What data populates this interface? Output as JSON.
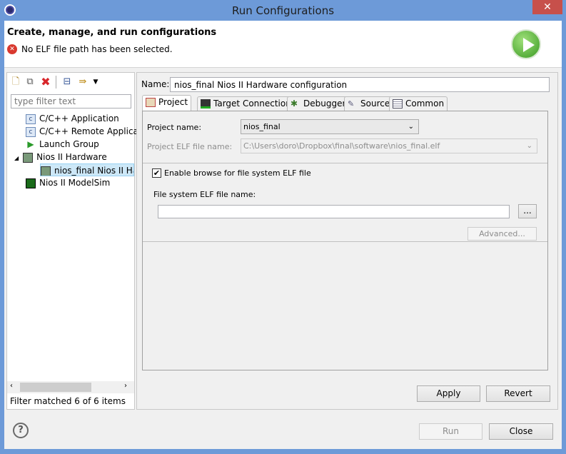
{
  "window": {
    "title": "Run Configurations",
    "close": "✕"
  },
  "header": {
    "title": "Create, manage, and run configurations",
    "error": "No ELF file path has been selected."
  },
  "toolbar": {
    "icons": [
      "new-config-icon",
      "duplicate-icon",
      "delete-icon",
      "collapse-all-icon",
      "filter-icon",
      "dropdown-icon"
    ]
  },
  "filter": {
    "placeholder": "type filter text"
  },
  "tree": [
    {
      "label": "C/C++ Application",
      "icon": "c-app-icon"
    },
    {
      "label": "C/C++ Remote Applicat",
      "icon": "c-app-icon"
    },
    {
      "label": "Launch Group",
      "icon": "launch-group-icon"
    },
    {
      "label": "Nios II Hardware",
      "icon": "nios-hardware-icon",
      "expanded": true
    },
    {
      "label": "nios_final Nios II Har",
      "icon": "nios-hardware-icon",
      "selected": true
    },
    {
      "label": "Nios II ModelSim",
      "icon": "modelsim-icon"
    }
  ],
  "status": "Filter matched 6 of 6 items",
  "config": {
    "name_label": "Name:",
    "name": "nios_final Nios II Hardware configuration"
  },
  "tabs": [
    "Project",
    "Target Connection",
    "Debugger",
    "Source",
    "Common"
  ],
  "project": {
    "project_name_label": "Project name:",
    "project_name": "nios_final",
    "elf_label": "Project ELF file name:",
    "elf_value": "C:\\Users\\doro\\Dropbox\\final\\software\\nios_final.elf",
    "browse_checkbox": "Enable browse for file system ELF file",
    "browse_checked": true,
    "fs_elf_label": "File system ELF file name:",
    "fs_elf_value": "",
    "browse_button": "...",
    "advanced_button": "Advanced..."
  },
  "buttons": {
    "apply": "Apply",
    "revert": "Revert",
    "run": "Run",
    "close": "Close",
    "help": "?"
  }
}
